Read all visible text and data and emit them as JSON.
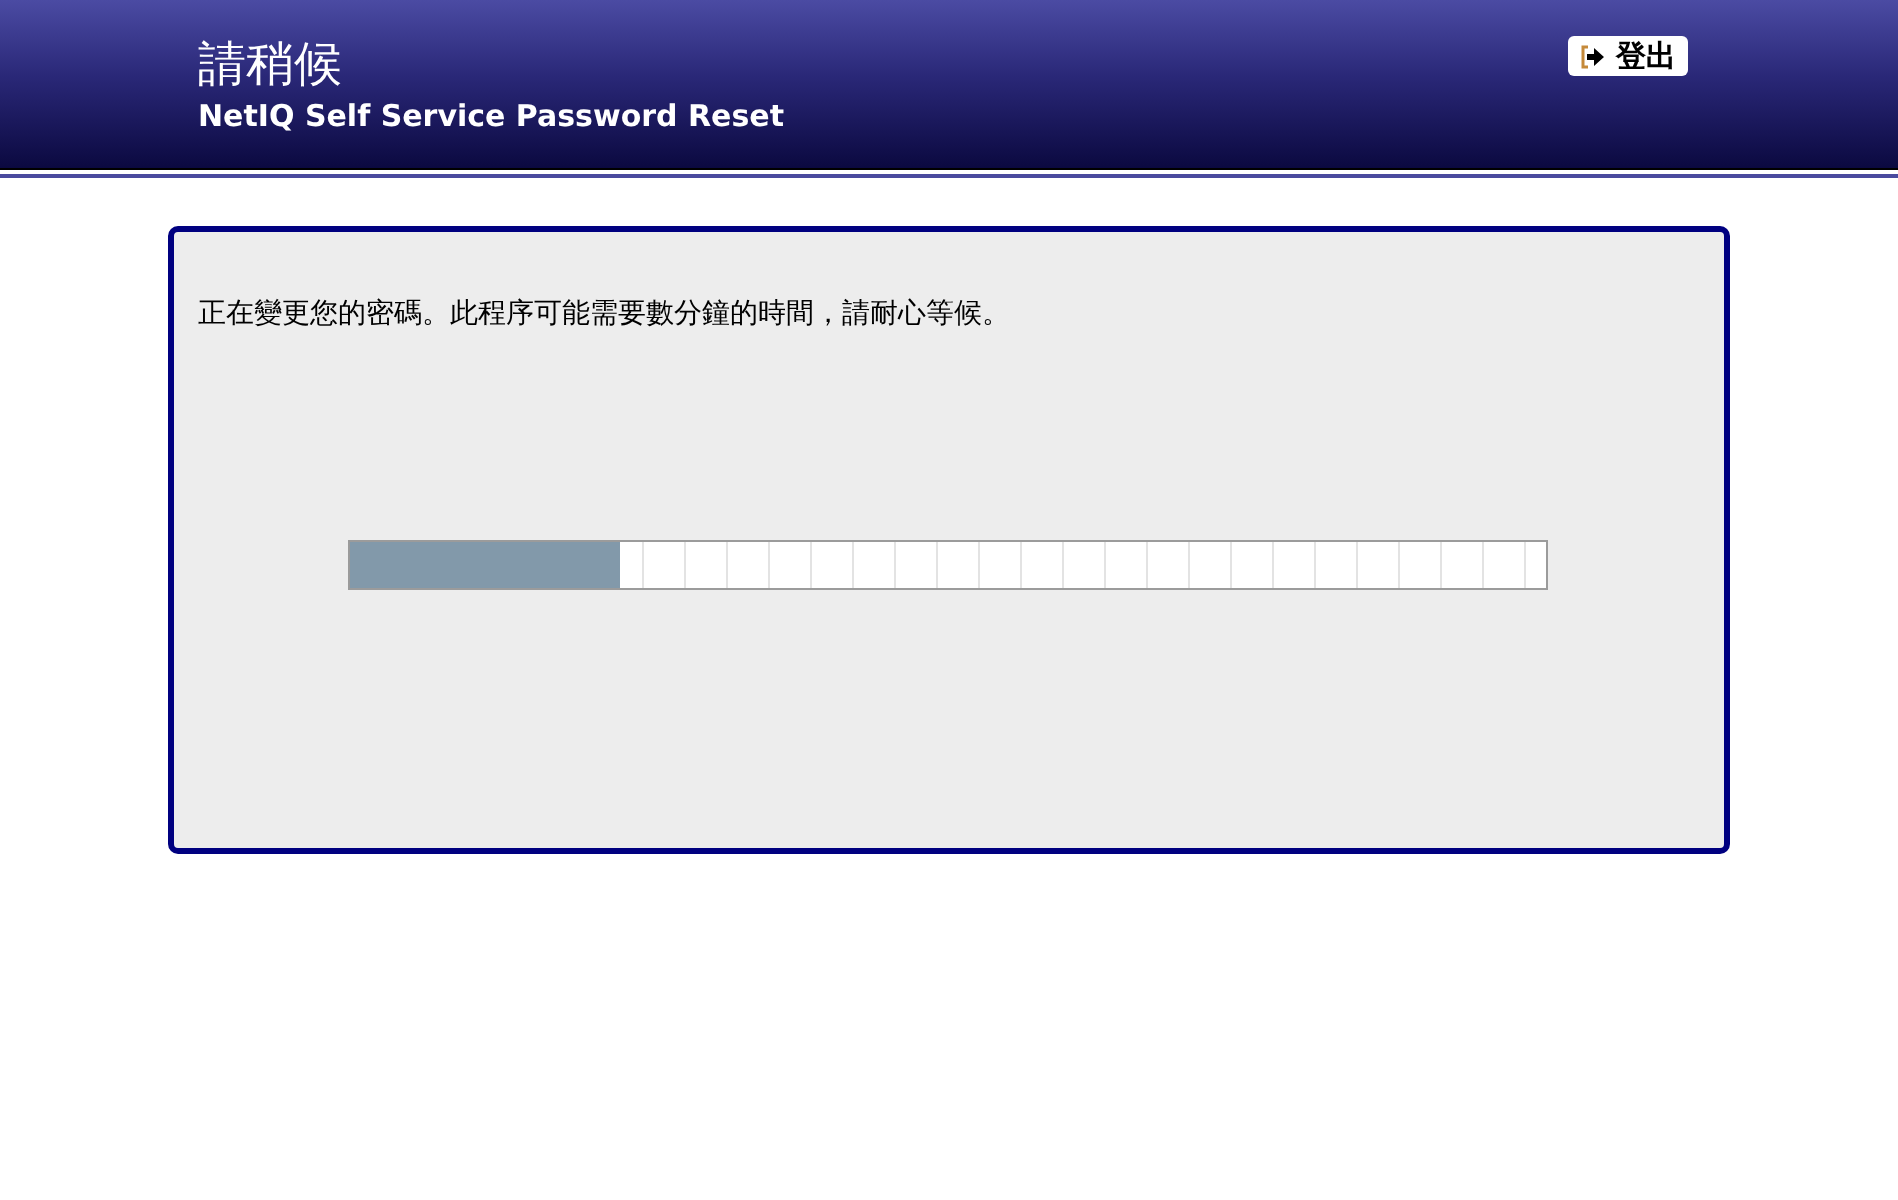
{
  "header": {
    "title": "請稍候",
    "subtitle": "NetIQ Self Service Password Reset",
    "logout_button": "登出"
  },
  "panel": {
    "message": "正在變更您的密碼。此程序可能需要數分鐘的時間，請耐心等候。",
    "progress": {
      "level": 0.225
    }
  }
}
